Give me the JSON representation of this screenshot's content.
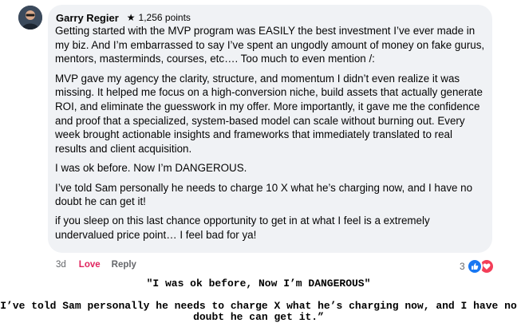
{
  "comment": {
    "author": "Garry Regier",
    "points": "1,256 points",
    "paragraphs": [
      "Getting started with the MVP program was EASILY the best investment I’ve ever made in my biz. And I’m embarrassed to say I’ve spent an ungodly amount of money on fake gurus, mentors, masterminds, courses, etc…. Too much to even mention /:",
      "MVP gave my agency the clarity, structure, and momentum I didn’t even realize it was missing. It helped me focus on a high-conversion niche, build assets that actually generate ROI, and eliminate the guesswork in my offer. More importantly, it gave me the confidence and proof that a specialized, system-based model can scale without burning out. Every week brought actionable insights and frameworks that immediately translated to real results and client acquisition.",
      "I was ok before. Now I’m DANGEROUS.",
      "I’ve told Sam personally he needs to charge 10 X what he’s charging now, and I have no doubt he can get it!",
      "if you sleep on this last chance opportunity to get in at what I feel is a extremely undervalued price point… I feel bad for ya!"
    ],
    "time": "3d",
    "love_label": "Love",
    "reply_label": "Reply",
    "reaction_count": "3",
    "reaction_icons": [
      "like-icon",
      "love-icon"
    ]
  },
  "captions": {
    "quote1": "\"I was ok before, Now I’m DANGEROUS\"",
    "quote2": "I’ve told Sam personally he needs to charge X what he’s charging now, and I have no doubt he can get it.”"
  },
  "colors": {
    "bubble": "#f0f2f5",
    "love": "#e0245e",
    "like_blue": "#1877f2",
    "love_red": "#f33e58"
  }
}
